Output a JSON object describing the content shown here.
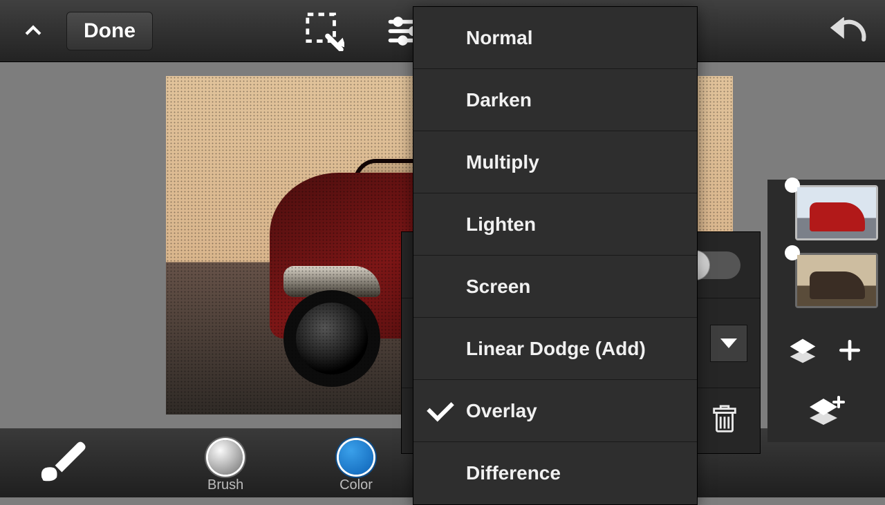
{
  "topbar": {
    "done_label": "Done"
  },
  "bottombar": {
    "brush_label": "Brush",
    "color_label": "Color"
  },
  "blend_modes": {
    "items": [
      {
        "label": "Normal",
        "selected": false
      },
      {
        "label": "Darken",
        "selected": false
      },
      {
        "label": "Multiply",
        "selected": false
      },
      {
        "label": "Lighten",
        "selected": false
      },
      {
        "label": "Screen",
        "selected": false
      },
      {
        "label": "Linear Dodge (Add)",
        "selected": false
      },
      {
        "label": "Overlay",
        "selected": true
      },
      {
        "label": "Difference",
        "selected": false
      }
    ]
  },
  "layers": {
    "items": [
      {
        "name": "layer-1-red-car",
        "visible": true,
        "selected": true
      },
      {
        "name": "layer-2-sepia-car",
        "visible": true,
        "selected": false
      }
    ]
  },
  "options_panel": {
    "toggle_on": false
  }
}
